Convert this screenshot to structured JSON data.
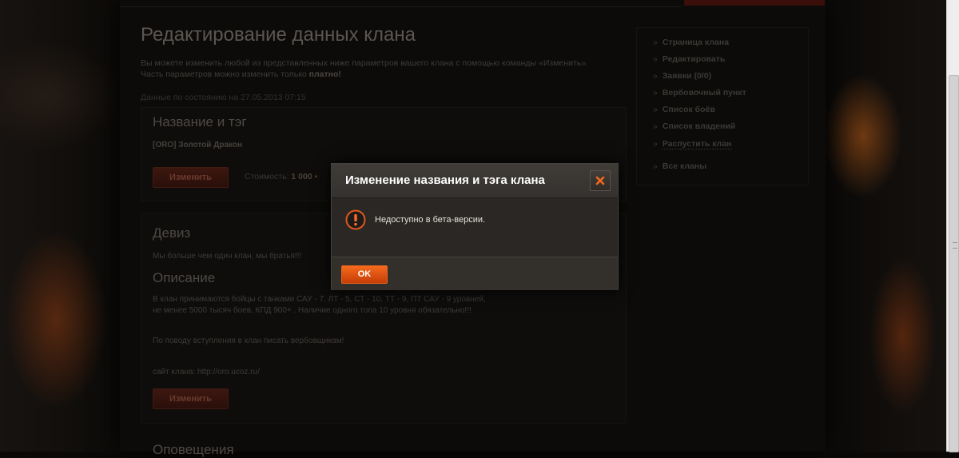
{
  "page": {
    "title": "Редактирование данных клана",
    "intro_line1": "Вы можете изменить любой из представленных ниже параметров вашего клана с помощью команды «Изменить».",
    "intro_line2_prefix": "Часть параметров можно изменить только ",
    "intro_line2_bold": "платно!",
    "date_line": "Данные по состоянию на 27.05.2013 07:15"
  },
  "name_section": {
    "title": "Название и тэг",
    "value": "[ORO] Золотой Дракон",
    "edit_button": "Изменить",
    "cost_label": "Стоимость:",
    "cost_value": "1 000"
  },
  "motto_section": {
    "title": "Девиз",
    "value": "Мы больше чем один клан, мы братья!!!"
  },
  "description_section": {
    "title": "Описание",
    "line1": "В клан принимаются бойцы с танками САУ - 7, ЛТ - 5, СТ - 10, ТТ - 9, ПТ САУ - 9 уровней,",
    "line2": "не менее 5000 тысяч боев, КПД 900+ . Наличие одного топа 10 уровня обязательно!!!",
    "line3": "По поводу вступления в клан писать вербовщикам!",
    "line4": "сайт клана: http://oro.ucoz.ru/",
    "edit_button": "Изменить"
  },
  "cut_section": {
    "title": "Оповещения"
  },
  "sidebar": {
    "items": [
      {
        "label": "Страница клана"
      },
      {
        "label": "Редактировать"
      },
      {
        "label": "Заявки (0/0)"
      },
      {
        "label": "Вербовочный пункт"
      },
      {
        "label": "Список боёв"
      },
      {
        "label": "Список владений"
      },
      {
        "label": "Распустить клан"
      },
      {
        "label": "Все кланы"
      }
    ]
  },
  "modal": {
    "title": "Изменение названия и тэга клана",
    "message": "Недоступно в бета-версии.",
    "ok_label": "OK",
    "icons": {
      "close": "close-icon",
      "alert": "alert-icon"
    }
  },
  "colors": {
    "accent": "#e8561a",
    "modal_bg": "#2c2926",
    "page_bg": "#0c0b0a"
  }
}
